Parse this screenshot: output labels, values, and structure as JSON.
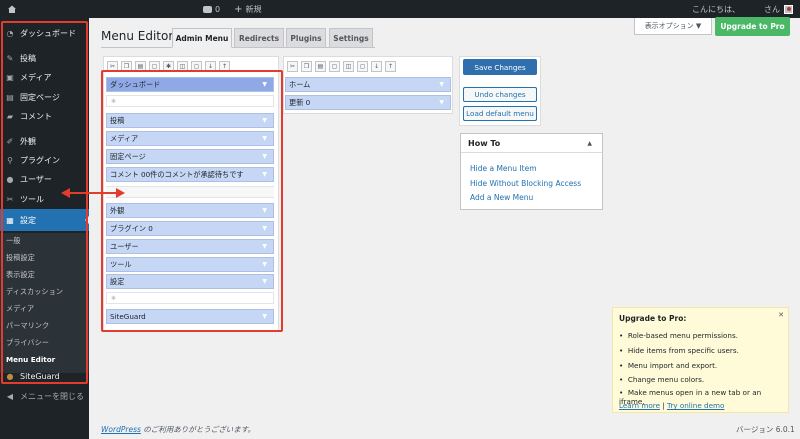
{
  "adminbar": {
    "comments_count": "0",
    "new_label": "新規",
    "greeting": "こんにちは、",
    "user_suffix": "さん"
  },
  "sidebar": {
    "items": [
      {
        "label": "ダッシュボード",
        "icon": "dashboard-icon"
      },
      {
        "label": "投稿",
        "icon": "pin-icon"
      },
      {
        "label": "メディア",
        "icon": "media-icon"
      },
      {
        "label": "固定ページ",
        "icon": "page-icon"
      },
      {
        "label": "コメント",
        "icon": "comment-icon"
      },
      {
        "label": "外観",
        "icon": "brush-icon"
      },
      {
        "label": "プラグイン",
        "icon": "plugin-icon"
      },
      {
        "label": "ユーザー",
        "icon": "user-icon"
      },
      {
        "label": "ツール",
        "icon": "wrench-icon"
      },
      {
        "label": "設定",
        "icon": "settings-icon"
      }
    ],
    "submenu": [
      "一般",
      "投稿設定",
      "表示設定",
      "ディスカッション",
      "メディア",
      "パーマリンク",
      "プライバシー",
      "Menu Editor"
    ],
    "siteguard": "SiteGuard",
    "collapse": "メニューを閉じる"
  },
  "header": {
    "title": "Menu Editor",
    "tabs": [
      "Admin Menu",
      "Redirects",
      "Plugins",
      "Settings"
    ],
    "screen_options": "表示オプション ▼",
    "upgrade_button": "Upgrade to Pro"
  },
  "left_menu": {
    "rows": [
      {
        "label": "ダッシュボード",
        "kind": "header"
      },
      {
        "label": "",
        "kind": "separator"
      },
      {
        "label": "投稿",
        "kind": "item"
      },
      {
        "label": "メディア",
        "kind": "item"
      },
      {
        "label": "固定ページ",
        "kind": "item"
      },
      {
        "label": "コメント 00件のコメントが承認待ちです",
        "kind": "item"
      },
      {
        "label": "",
        "kind": "gap"
      },
      {
        "label": "外観",
        "kind": "item"
      },
      {
        "label": "プラグイン 0",
        "kind": "item"
      },
      {
        "label": "ユーザー",
        "kind": "item"
      },
      {
        "label": "ツール",
        "kind": "item"
      },
      {
        "label": "設定",
        "kind": "item"
      },
      {
        "label": "",
        "kind": "separator"
      },
      {
        "label": "SiteGuard",
        "kind": "item"
      }
    ]
  },
  "right_menu": {
    "rows": [
      "ホーム",
      "更新 0"
    ]
  },
  "buttons": {
    "save": "Save Changes",
    "undo": "Undo changes",
    "load_default": "Load default menu"
  },
  "howto": {
    "title": "How To",
    "links": [
      "Hide a Menu Item",
      "Hide Without Blocking Access",
      "Add a New Menu"
    ]
  },
  "upgrade_box": {
    "title": "Upgrade to Pro:",
    "bullets": [
      "Role-based menu permissions.",
      "Hide items from specific users.",
      "Menu import and export.",
      "Change menu colors.",
      "Make menus open in a new tab or an iframe."
    ],
    "learn_more": "Learn more",
    "separator": "|",
    "try_demo": "Try online demo"
  },
  "footer": {
    "wordpress_link": "WordPress",
    "thanks": " のご利用ありがとうございます。",
    "version": "バージョン 6.0.1"
  },
  "colors": {
    "accent": "#2271b1",
    "annotation": "#e33b2e",
    "menu_row": "#c5d7f5",
    "upgrade_green": "#4ab866"
  }
}
